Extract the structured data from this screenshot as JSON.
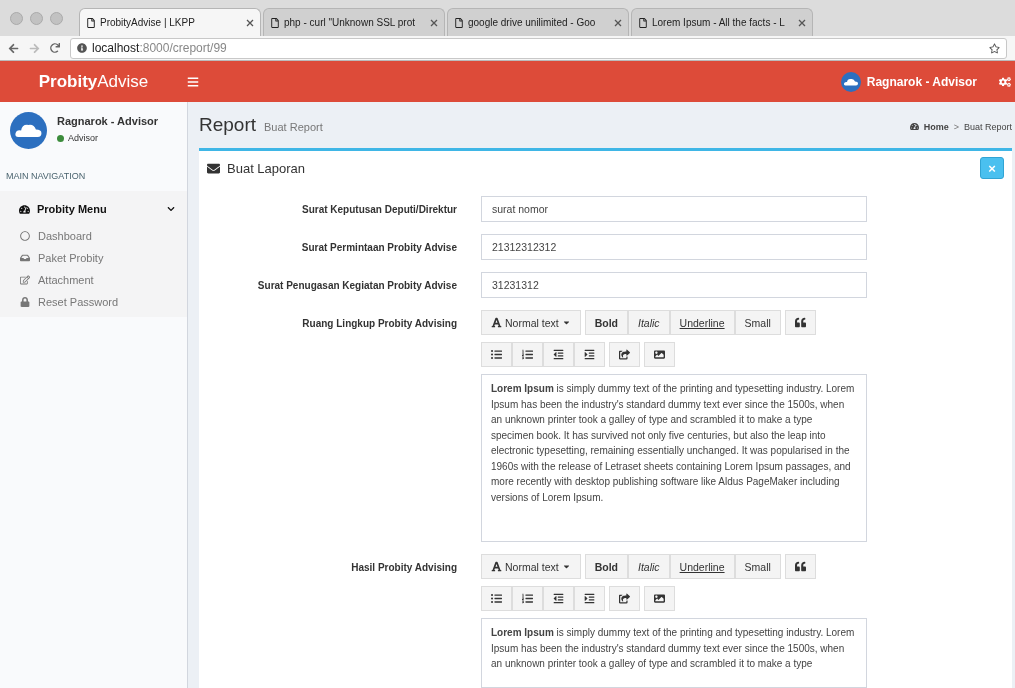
{
  "browser": {
    "tabs": [
      {
        "title": "ProbityAdvise | LKPP",
        "selected": true
      },
      {
        "title": "php - curl \"Unknown SSL prot",
        "selected": false
      },
      {
        "title": "google drive unilimited - Goo",
        "selected": false
      },
      {
        "title": "Lorem Ipsum - All the facts - L",
        "selected": false
      }
    ],
    "url_host": "localhost",
    "url_path": ":8000/creport/99"
  },
  "header": {
    "logo_bold": "Probity",
    "logo_light": "Advise",
    "user": "Ragnarok - Advisor"
  },
  "sidebar": {
    "user": "Ragnarok - Advisor",
    "status": "Advisor",
    "section": "MAIN NAVIGATION",
    "menu": {
      "label": "Probity Menu",
      "expanded": true,
      "items": [
        {
          "label": "Dashboard",
          "kind": "circle"
        },
        {
          "label": "Paket Probity",
          "kind": "inbox"
        },
        {
          "label": "Attachment",
          "kind": "edit"
        },
        {
          "label": "Reset Password",
          "kind": "lock"
        }
      ]
    }
  },
  "page": {
    "title": "Report",
    "subtitle": "Buat Report",
    "breadcrumb": [
      "Home",
      "Buat Report"
    ],
    "breadcrumb_separator": ">"
  },
  "box": {
    "title": "Buat Laporan",
    "close": "×",
    "fields": [
      {
        "label": "Surat Keputusan Deputi/Direktur",
        "value": "surat nomor"
      },
      {
        "label": "Surat Permintaan Probity Advise",
        "value": "21312312312"
      },
      {
        "label": "Surat Penugasan Kegiatan Probity Advise",
        "value": "31231312"
      }
    ],
    "editors": [
      {
        "label": "Ruang Lingkup Probity Advising",
        "format": "Normal text",
        "styles": [
          {
            "label": "Bold",
            "kind": "bold"
          },
          {
            "label": "Italic",
            "kind": "italic"
          },
          {
            "label": "Underline",
            "kind": "underline"
          },
          {
            "label": "Small",
            "kind": "small"
          }
        ],
        "text": "**Lorem Ipsum** is simply dummy text of the printing and typesetting industry. Lorem Ipsum has been the industry's standard dummy text ever since the 1500s, when an unknown printer took a galley of type and scrambled it to make a type specimen book. It has survived not only five centuries, but also the leap into electronic typesetting, remaining essentially unchanged. It was popularised in the 1960s with the release of Letraset sheets containing Lorem Ipsum passages, and more recently with desktop publishing software like Aldus PageMaker including versions of Lorem Ipsum."
      },
      {
        "label": "Hasil Probity Advising",
        "format": "Normal text",
        "styles": [
          {
            "label": "Bold",
            "kind": "bold"
          },
          {
            "label": "Italic",
            "kind": "italic"
          },
          {
            "label": "Underline",
            "kind": "underline"
          },
          {
            "label": "Small",
            "kind": "small"
          }
        ],
        "text": "**Lorem Ipsum** is simply dummy text of the printing and typesetting industry. Lorem Ipsum has been the industry's standard dummy text ever since the 1500s, when an unknown printer took a galley of type and scrambled it to make a type"
      }
    ]
  }
}
